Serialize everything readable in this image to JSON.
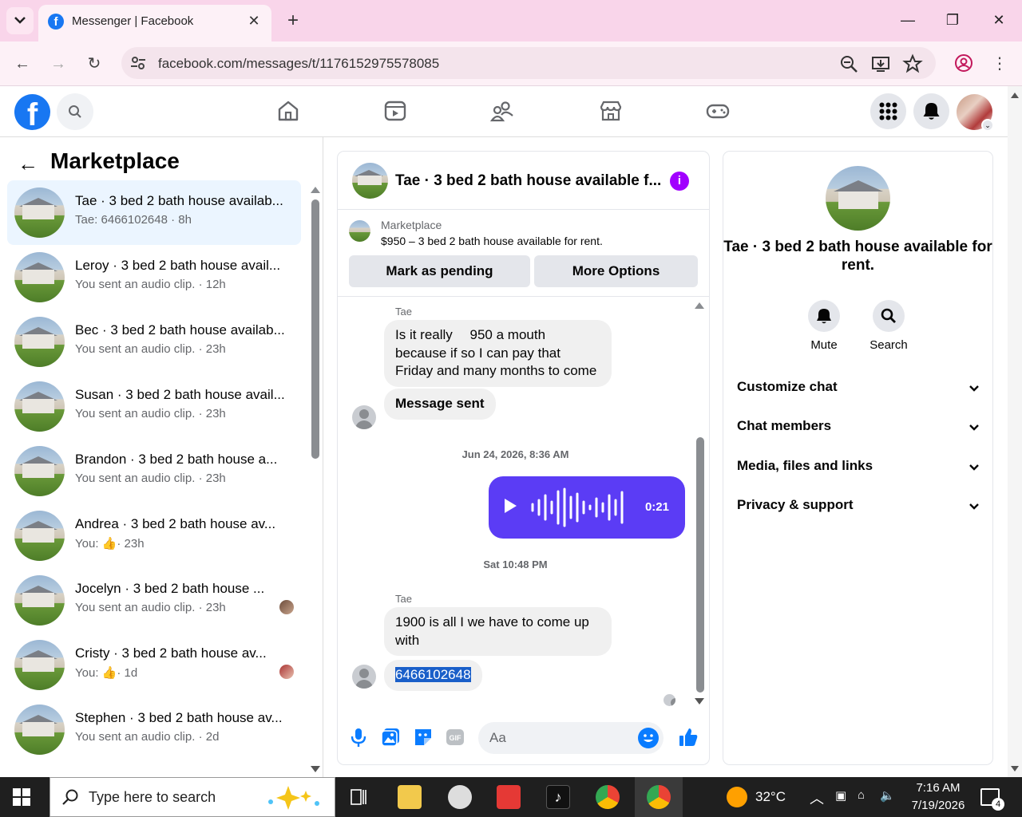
{
  "browser": {
    "tab_title": "Messenger | Facebook",
    "url": "facebook.com/messages/t/1176152975578085"
  },
  "sidebar": {
    "heading": "Marketplace",
    "conversations": [
      {
        "name": "Tae · 3 bed 2 bath house availab...",
        "sub": "Tae: 6466102648 · 8h"
      },
      {
        "name": "Leroy · 3 bed 2 bath house avail...",
        "sub": "You sent an audio clip. · 12h"
      },
      {
        "name": "Bec · 3 bed 2 bath house availab...",
        "sub": "You sent an audio clip. · 23h"
      },
      {
        "name": "Susan · 3 bed 2 bath house avail...",
        "sub": "You sent an audio clip. · 23h"
      },
      {
        "name": "Brandon · 3 bed 2 bath house a...",
        "sub": "You sent an audio clip. · 23h"
      },
      {
        "name": "Andrea · 3 bed 2 bath house av...",
        "sub_prefix": "You:",
        "sub": "· 23h"
      },
      {
        "name": "Jocelyn · 3 bed 2 bath house ...",
        "sub": "You sent an audio clip. · 23h"
      },
      {
        "name": "Cristy · 3 bed 2 bath house av...",
        "sub_prefix": "You:",
        "sub": "· 1d"
      },
      {
        "name": "Stephen · 3 bed 2 bath house av...",
        "sub": "You sent an audio clip. · 2d"
      }
    ]
  },
  "chat": {
    "title": "Tae · 3 bed 2 bath house available f...",
    "marketplace_label": "Marketplace",
    "listing": "$950 – 3 bed 2 bath house available for rent.",
    "mark_pending": "Mark as pending",
    "more_options": "More Options",
    "sender1": "Tae",
    "msg1": "Is it really  950 a mouth because if so I can pay that Friday and many months to come",
    "msg2": "Message sent",
    "time1": "Jun 24, 2026, 8:36 AM",
    "audio_duration": "0:21",
    "time2": "Sat 10:48 PM",
    "sender2": "Tae",
    "msg3": "1900 is all I we have to come up with",
    "msg4": "6466102648",
    "composer_placeholder": "Aa"
  },
  "details": {
    "title": "Tae · 3 bed 2 bath house available for rent.",
    "mute": "Mute",
    "search": "Search",
    "sections": [
      "Customize chat",
      "Chat members",
      "Media, files and links",
      "Privacy & support"
    ]
  },
  "taskbar": {
    "search_placeholder": "Type here to search",
    "temperature": "32°C",
    "time": "7:16 AM",
    "date": "7/19/2026",
    "notifications": "4"
  },
  "colors": {
    "fb_blue": "#1877f2",
    "audio_bubble": "#5b3cf5",
    "active_row": "#ebf5ff",
    "info_purple": "#a100ff"
  }
}
